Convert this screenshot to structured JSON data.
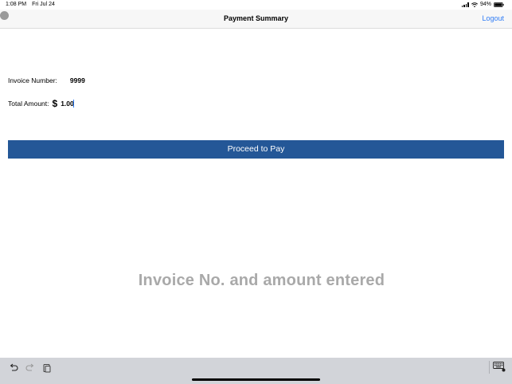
{
  "status_bar": {
    "time": "1:08 PM",
    "date": "Fri Jul 24",
    "battery": "94%"
  },
  "nav": {
    "title": "Payment Summary",
    "logout_label": "Logout"
  },
  "form": {
    "invoice_label": "Invoice Number:",
    "invoice_value": "9999",
    "amount_label": "Total Amount:",
    "currency_symbol": "$",
    "amount_value": "1.00"
  },
  "pay_button_label": "Proceed to Pay",
  "caption": "Invoice No. and amount entered",
  "icons": {
    "signal": "signal-icon",
    "wifi": "wifi-icon",
    "battery": "battery-icon",
    "undo": "undo-icon",
    "redo": "redo-icon",
    "paste": "paste-icon",
    "keyboard_dismiss": "keyboard-dismiss-icon"
  },
  "colors": {
    "accent": "#2f7cf6",
    "button": "#245797",
    "caption": "#a9a9a9"
  }
}
